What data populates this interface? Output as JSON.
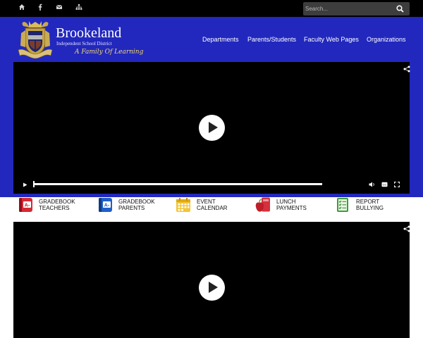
{
  "topbar": {
    "icons": [
      "home-icon",
      "facebook-icon",
      "envelope-icon",
      "sitemap-icon"
    ],
    "search_placeholder": "Search..."
  },
  "brand": {
    "name": "Brookeland",
    "subtitle": "Independent School District",
    "tagline": "A Family Of Learning"
  },
  "nav": {
    "items": [
      {
        "label": "Departments"
      },
      {
        "label": "Parents/Students"
      },
      {
        "label": "Faculty Web Pages"
      },
      {
        "label": "Organizations"
      }
    ]
  },
  "quick_links": [
    {
      "line1": "GRADEBOOK",
      "line2": "TEACHERS",
      "icon": "gradebook-red-icon"
    },
    {
      "line1": "GRADEBOOK",
      "line2": "PARENTS",
      "icon": "gradebook-blue-icon"
    },
    {
      "line1": "EVENT",
      "line2": "CALENDAR",
      "icon": "calendar-icon"
    },
    {
      "line1": "LUNCH",
      "line2": "PAYMENTS",
      "icon": "apple-icon"
    },
    {
      "line1": "REPORT",
      "line2": "BULLYING",
      "icon": "checklist-icon"
    }
  ],
  "colors": {
    "banner": "#2228bd",
    "topbar": "#000000",
    "tagline": "#f3d86f"
  }
}
